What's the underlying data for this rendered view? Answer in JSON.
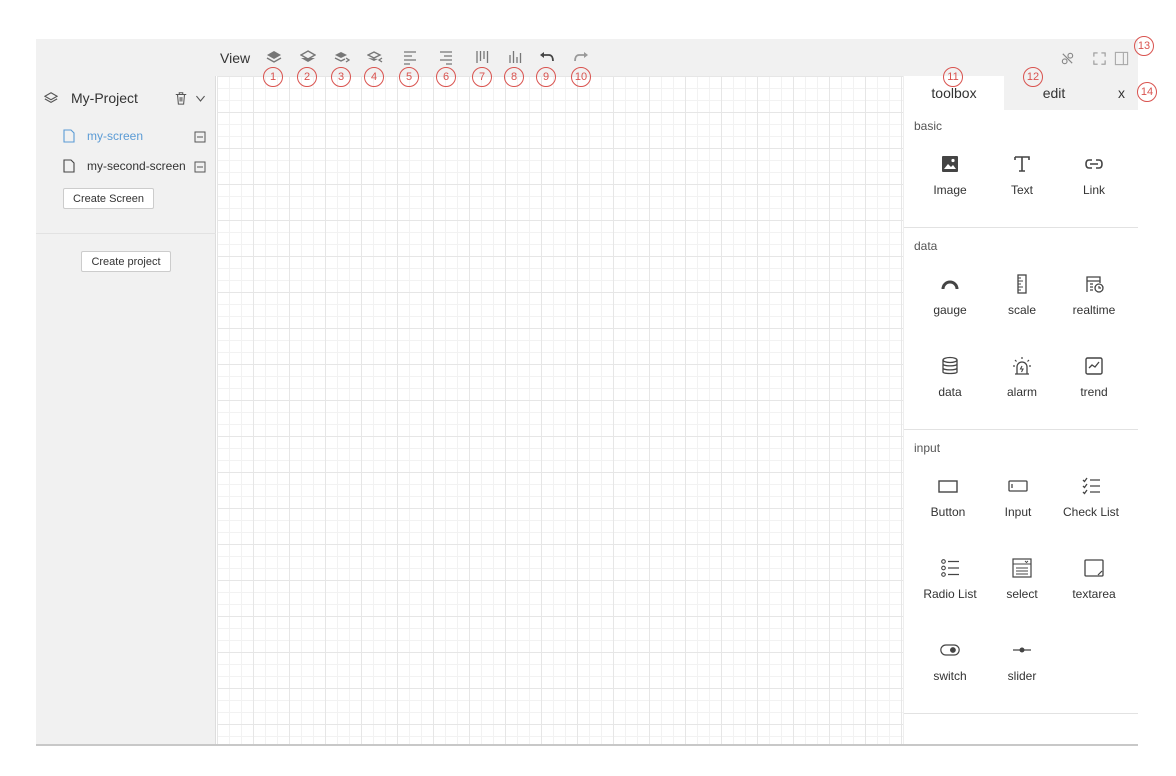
{
  "toolbar": {
    "view_label": "View",
    "icons": [
      "layer-up-icon",
      "layer-down-icon",
      "bring-forward-icon",
      "send-backward-icon",
      "align-left-icon",
      "align-right-icon",
      "distribute-horizontal-icon",
      "distribute-vertical-icon",
      "undo-icon",
      "redo-icon"
    ],
    "right_icons": [
      "disconnect-icon",
      "fullscreen-icon",
      "panel-toggle-icon"
    ]
  },
  "sidebar": {
    "project_name": "My-Project",
    "screens": [
      {
        "label": "my-screen",
        "active": true
      },
      {
        "label": "my-second-screen",
        "active": false
      }
    ],
    "create_screen_label": "Create Screen",
    "create_project_label": "Create project"
  },
  "panel": {
    "tabs": [
      {
        "label": "toolbox",
        "active": true
      },
      {
        "label": "edit",
        "active": false
      },
      {
        "label": "x",
        "active": false
      }
    ],
    "sections": [
      {
        "title": "basic",
        "items": [
          {
            "label": "Image",
            "icon": "image-icon"
          },
          {
            "label": "Text",
            "icon": "text-icon"
          },
          {
            "label": "Link",
            "icon": "link-icon"
          }
        ]
      },
      {
        "title": "data",
        "items": [
          {
            "label": "gauge",
            "icon": "gauge-icon"
          },
          {
            "label": "scale",
            "icon": "scale-icon"
          },
          {
            "label": "realtime",
            "icon": "realtime-icon"
          },
          {
            "label": "data",
            "icon": "database-icon"
          },
          {
            "label": "alarm",
            "icon": "alarm-icon"
          },
          {
            "label": "trend",
            "icon": "trend-icon"
          }
        ]
      },
      {
        "title": "input",
        "items": [
          {
            "label": "Button",
            "icon": "button-icon"
          },
          {
            "label": "Input",
            "icon": "input-icon"
          },
          {
            "label": "Check List",
            "icon": "checklist-icon"
          },
          {
            "label": "Radio List",
            "icon": "radiolist-icon"
          },
          {
            "label": "select",
            "icon": "select-icon"
          },
          {
            "label": "textarea",
            "icon": "textarea-icon"
          },
          {
            "label": "switch",
            "icon": "switch-icon"
          },
          {
            "label": "slider",
            "icon": "slider-icon"
          }
        ]
      }
    ]
  },
  "callouts": [
    "1",
    "2",
    "3",
    "4",
    "5",
    "6",
    "7",
    "8",
    "9",
    "10",
    "11",
    "12",
    "13",
    "14"
  ],
  "colors": {
    "accent": "#5b9bd5",
    "callout": "#d9534f",
    "chrome": "#f1f1f1"
  }
}
